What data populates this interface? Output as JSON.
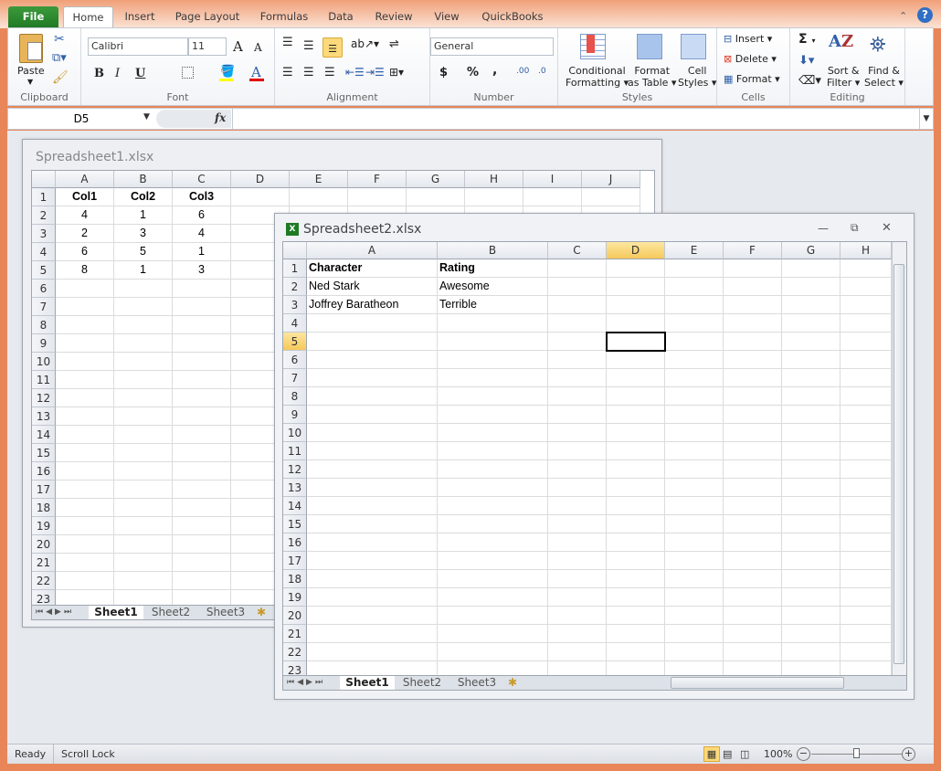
{
  "ribbon": {
    "tabs": [
      "File",
      "Home",
      "Insert",
      "Page Layout",
      "Formulas",
      "Data",
      "Review",
      "View",
      "QuickBooks"
    ],
    "clipboard": {
      "paste": "Paste",
      "label": "Clipboard"
    },
    "font": {
      "name": "Calibri",
      "size": "11",
      "label": "Font",
      "bold": "B",
      "italic": "I",
      "underline": "U",
      "grow": "A",
      "shrink": "A",
      "font_color": "A"
    },
    "alignment": {
      "label": "Alignment"
    },
    "number": {
      "format": "General",
      "label": "Number",
      "currency": "$",
      "percent": "%",
      "comma": ",",
      "inc": ".00",
      "dec": ".0"
    },
    "styles": {
      "label": "Styles",
      "conditional": [
        "Conditional",
        "Formatting"
      ],
      "table": [
        "Format",
        "as Table"
      ],
      "cell": [
        "Cell",
        "Styles"
      ]
    },
    "cells": {
      "label": "Cells",
      "insert": "Insert",
      "delete": "Delete",
      "format": "Format"
    },
    "editing": {
      "label": "Editing",
      "sum": "Σ",
      "sort": [
        "Sort &",
        "Filter"
      ],
      "find": [
        "Find &",
        "Select"
      ]
    },
    "accent": "#1F7A24"
  },
  "formula_bar": {
    "name_box": "D5",
    "fx": "fx",
    "value": ""
  },
  "windows": [
    {
      "title": "Spreadsheet1.xlsx",
      "columns": [
        "A",
        "B",
        "C",
        "D",
        "E",
        "F",
        "G",
        "H",
        "I",
        "J"
      ],
      "rows": 23,
      "cells": [
        [
          "Col1",
          "Col2",
          "Col3"
        ],
        [
          "4",
          "1",
          "6"
        ],
        [
          "2",
          "3",
          "4"
        ],
        [
          "6",
          "5",
          "1"
        ],
        [
          "8",
          "1",
          "3"
        ]
      ],
      "sheets": [
        "Sheet1",
        "Sheet2",
        "Sheet3"
      ],
      "active_sheet": "Sheet1"
    },
    {
      "title": "Spreadsheet2.xlsx",
      "columns": [
        "A",
        "B",
        "C",
        "D",
        "E",
        "F",
        "G",
        "H"
      ],
      "rows": 23,
      "cells": [
        [
          "Character",
          "Rating"
        ],
        [
          "Ned Stark",
          "Awesome"
        ],
        [
          "Joffrey Baratheon",
          "Terrible"
        ]
      ],
      "sheets": [
        "Sheet1",
        "Sheet2",
        "Sheet3"
      ],
      "active_sheet": "Sheet1",
      "selected_cell": "D5"
    }
  ],
  "status": {
    "ready": "Ready",
    "scroll_lock": "Scroll Lock",
    "zoom": "100%",
    "zoom_level": 1.0
  }
}
